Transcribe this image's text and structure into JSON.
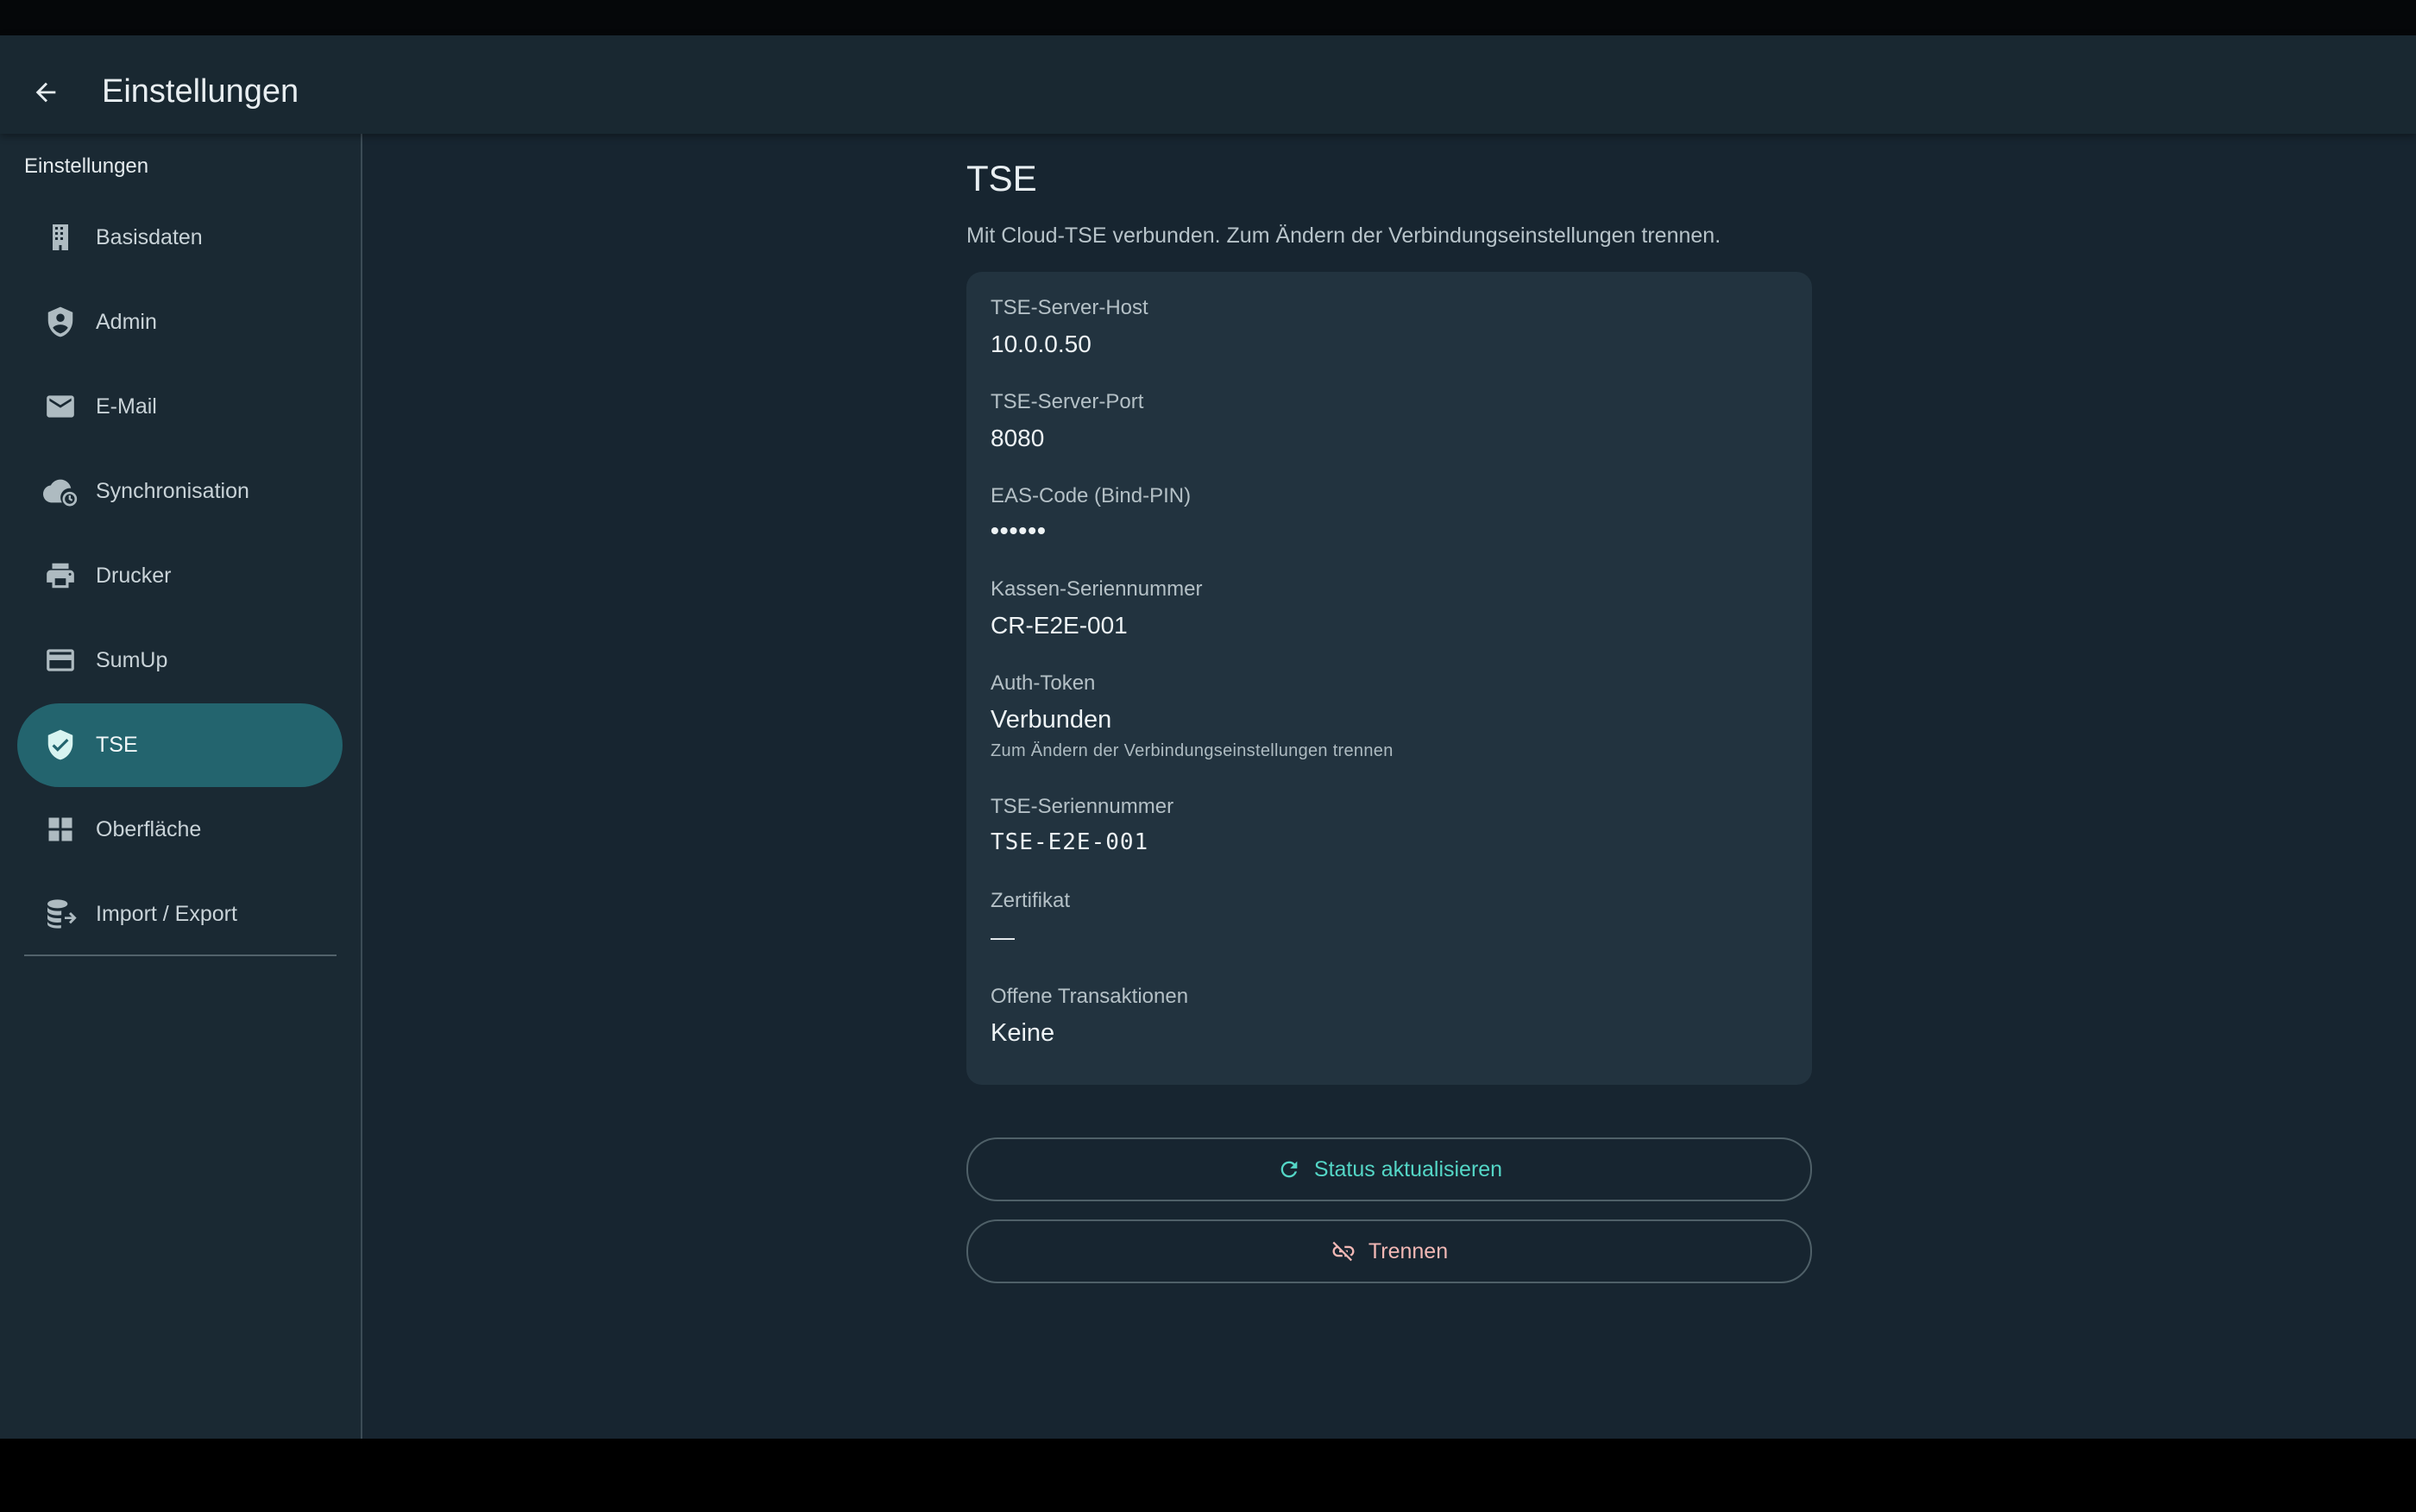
{
  "header": {
    "title": "Einstellungen",
    "back_icon": "arrow-left-icon"
  },
  "sidebar": {
    "heading": "Einstellungen",
    "items": [
      {
        "label": "Basisdaten",
        "icon": "building-icon"
      },
      {
        "label": "Admin",
        "icon": "admin-shield-icon"
      },
      {
        "label": "E-Mail",
        "icon": "email-icon"
      },
      {
        "label": "Synchronisation",
        "icon": "cloud-sync-icon"
      },
      {
        "label": "Drucker",
        "icon": "printer-icon"
      },
      {
        "label": "SumUp",
        "icon": "credit-card-icon"
      },
      {
        "label": "TSE",
        "icon": "verified-shield-icon",
        "active": true
      },
      {
        "label": "Oberfläche",
        "icon": "dashboard-grid-icon"
      },
      {
        "label": "Import / Export",
        "icon": "database-export-icon"
      }
    ]
  },
  "main": {
    "title": "TSE",
    "subtitle": "Mit Cloud-TSE verbunden. Zum Ändern der Verbindungseinstellungen trennen.",
    "fields": {
      "host": {
        "label": "TSE-Server-Host",
        "value": "10.0.0.50"
      },
      "port": {
        "label": "TSE-Server-Port",
        "value": "8080"
      },
      "eas": {
        "label": "EAS-Code (Bind-PIN)",
        "value": "••••••"
      },
      "serial": {
        "label": "Kassen-Seriennummer",
        "value": "CR-E2E-001"
      },
      "token": {
        "label": "Auth-Token",
        "value": "Verbunden",
        "help": "Zum Ändern der Verbindungseinstellungen trennen"
      },
      "tse_serial": {
        "label": "TSE-Seriennummer",
        "value": "TSE-E2E-001"
      },
      "cert": {
        "label": "Zertifikat",
        "value": "—"
      },
      "open_tx": {
        "label": "Offene Transaktionen",
        "value": "Keine"
      }
    },
    "buttons": {
      "refresh": "Status aktualisieren",
      "disconnect": "Trennen"
    }
  },
  "colors": {
    "accent": "#54d6c6",
    "active_nav": "#23646e",
    "danger_text": "#f2b8b5",
    "background": "#172530",
    "card": "#22333f"
  }
}
